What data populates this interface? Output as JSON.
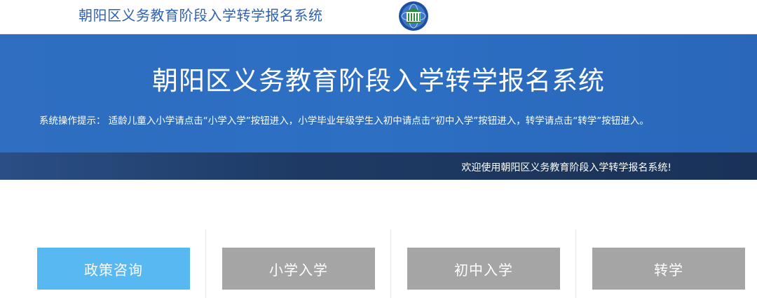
{
  "header": {
    "title": "朝阳区义务教育阶段入学转学报名系统",
    "logo_icon": "globe-emblem-icon"
  },
  "banner": {
    "title": "朝阳区义务教育阶段入学转学报名系统",
    "tip": "系统操作提示： 适龄儿童入小学请点击“小学入学”按钮进入，小学毕业年级学生入初中请点击“初中入学”按钮进入，转学请点击“转学”按钮进入。"
  },
  "welcome": {
    "text": "欢迎使用朝阳区义务教育阶段入学转学报名系统!"
  },
  "nav": {
    "buttons": [
      {
        "label": "政策咨询",
        "state": "active"
      },
      {
        "label": "小学入学",
        "state": "default"
      },
      {
        "label": "初中入学",
        "state": "default"
      },
      {
        "label": "转学",
        "state": "default"
      }
    ]
  },
  "colors": {
    "active": "#58b8f2",
    "default": "#a5a5a5",
    "banner": "#2c6fc3",
    "welcome_bar": "#1e3a64",
    "header_text": "#2f62b0"
  }
}
